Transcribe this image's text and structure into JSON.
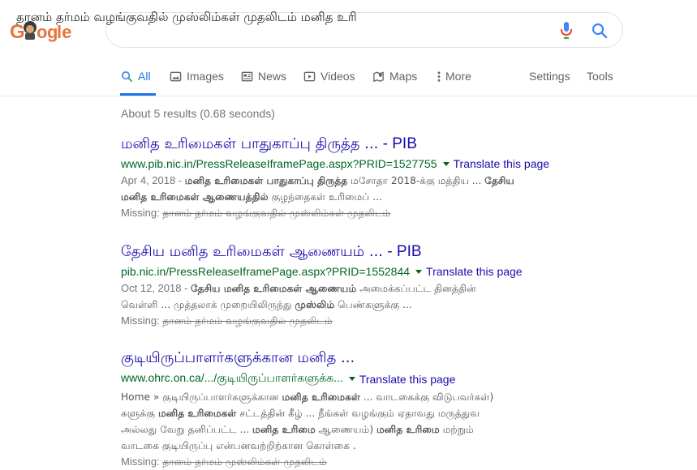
{
  "logo_text": "Google",
  "search": {
    "query": "தானம் தர்மம் வழங்குவதில் முஸ்லிம்கள் முதலிடம் மனித உரி"
  },
  "tabs": {
    "all": "All",
    "images": "Images",
    "news": "News",
    "videos": "Videos",
    "maps": "Maps",
    "more": "More",
    "settings": "Settings",
    "tools": "Tools"
  },
  "stats": "About 5 results (0.68 seconds)",
  "results": [
    {
      "title": "மனித உரிமைகள் பாதுகாப்பு திருத்த ...",
      "title_site": " - PIB",
      "url": "www.pib.nic.in/PressReleaseIframePage.aspx?PRID=1527755",
      "translate": "Translate this page",
      "date": "Apr 4, 2018 - ",
      "snippet_b1": "மனித உரிமைகள் பாதுகாப்பு திருத்த",
      "snippet_t1": " மசோதா 2018-க்கு மத்திய ... ",
      "snippet_b2": "தேசிய",
      "snippet_line2_b": "மனித உரிமைகள் ஆணையத்தில்",
      "snippet_line2_t": " குழந்தைகள் உரிமைப் ...",
      "missing_label": "Missing: ",
      "missing_terms": "தானம் தர்மம் வழங்குவதில் முஸ்லிம்கள் முதலிடம்"
    },
    {
      "title": "தேசிய மனித உரிமைகள் ஆணையம் ...",
      "title_site": " - PIB",
      "url": "pib.nic.in/PressReleaseIframePage.aspx?PRID=1552844",
      "translate": "Translate this page",
      "date": "Oct 12, 2018 - ",
      "snippet_b1": "தேசிய மனித உரிமைகள் ஆணையம்",
      "snippet_t1": " அமைக்கப்பட்ட தினத்தின்",
      "snippet_line2_t1": "வெள்ளி ... முத்தலாக் முறையிலிருந்து ",
      "snippet_line2_b": "முஸ்லிம்",
      "snippet_line2_t2": " பெண்களுக்கு ...",
      "missing_label": "Missing: ",
      "missing_terms": "தானம் தர்மம் வழங்குவதில் முதலிடம்"
    },
    {
      "title": "குடியிருப்பாளர்களுக்கான மனித ...",
      "url": "www.ohrc.on.ca/.../குடியிருப்பாளர்களுக்க...",
      "translate": "Translate this page",
      "line1_t": "Home » குடியிருப்பாளர்களுக்கான ",
      "line1_b": "மனித உரிமைகள்",
      "line1_t2": " ... வாடகைக்கு விடுபவர்கள்)",
      "line2_t": "களுக்கு ",
      "line2_b": "மனித உரிமைகள்",
      "line2_t2": " சட்டத்தின் கீழ் ... நீங்கள் வழங்கும் ஏதாவது மருத்துவ",
      "line3_t": "அல்லது வேறு தனிப்பட்ட ... ",
      "line3_b": "மனித உரிமை",
      "line3_t2": " ஆணையம்) ",
      "line3_b2": "மனித உரிமை",
      "line3_t3": " மற்றும்",
      "line4_t": "வாடகை குடியிருப்பு என்பனவற்றிற்கான கொள்கை .",
      "missing_label": "Missing: ",
      "missing_terms": "தானம் தர்மம் முஸ்லிம்கள் முதலிடம்"
    }
  ],
  "colors": {
    "link": "#1a0dab",
    "url": "#006621",
    "accent": "#1a73e8",
    "snippet": "#545454"
  }
}
